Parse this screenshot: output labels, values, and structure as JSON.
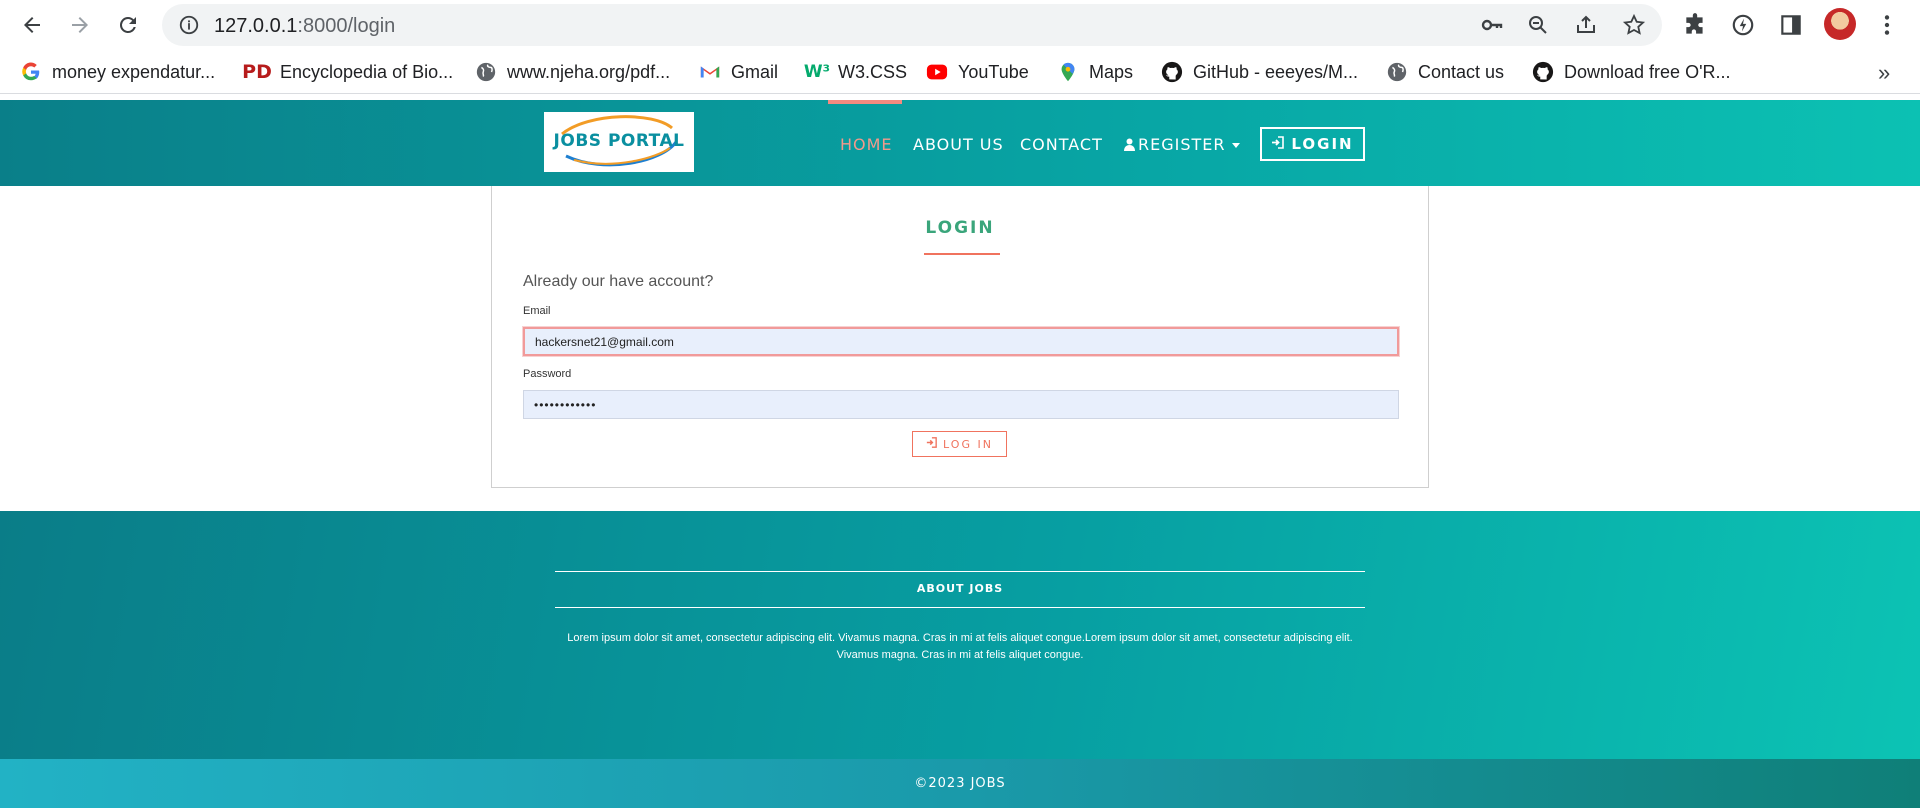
{
  "browser": {
    "url_host": "127.0.0.1",
    "url_path": ":8000/login",
    "bookmarks": [
      {
        "label": "money expendatur...",
        "icon": "google-icon"
      },
      {
        "label": "Encyclopedia of Bio...",
        "icon": "pd-icon"
      },
      {
        "label": "www.njeha.org/pdf...",
        "icon": "globe-icon"
      },
      {
        "label": "Gmail",
        "icon": "gmail-icon"
      },
      {
        "label": "W3.CSS",
        "icon": "w3-icon"
      },
      {
        "label": "YouTube",
        "icon": "youtube-icon"
      },
      {
        "label": "Maps",
        "icon": "maps-icon"
      },
      {
        "label": "GitHub - eeeyes/M...",
        "icon": "github-icon"
      },
      {
        "label": "Contact us",
        "icon": "globe-icon"
      },
      {
        "label": "Download free O'R...",
        "icon": "github-icon"
      }
    ],
    "more_label": "»"
  },
  "site": {
    "logo_text": "JOBS PORTAL",
    "nav": {
      "home": "HOME",
      "about": "ABOUT US",
      "contact": "CONTACT",
      "register": "REGISTER",
      "login": "LOGIN"
    },
    "accent_color": "#f0735e",
    "brand_teal": "#0a8f98"
  },
  "login_form": {
    "title": "LOGIN",
    "subtitle": "Already our have account?",
    "email_label": "Email",
    "email_value": "hackersnet21@gmail.com",
    "password_label": "Password",
    "password_value": "••••••••••••",
    "submit_label": "LOG IN"
  },
  "footer": {
    "heading": "ABOUT JOBS",
    "text": "Lorem ipsum dolor sit amet, consectetur adipiscing elit. Vivamus magna. Cras in mi at felis aliquet congue.Lorem ipsum dolor sit amet, consectetur adipiscing elit. Vivamus magna. Cras in mi at felis aliquet congue.",
    "copyright": "©2023 JOBS"
  }
}
